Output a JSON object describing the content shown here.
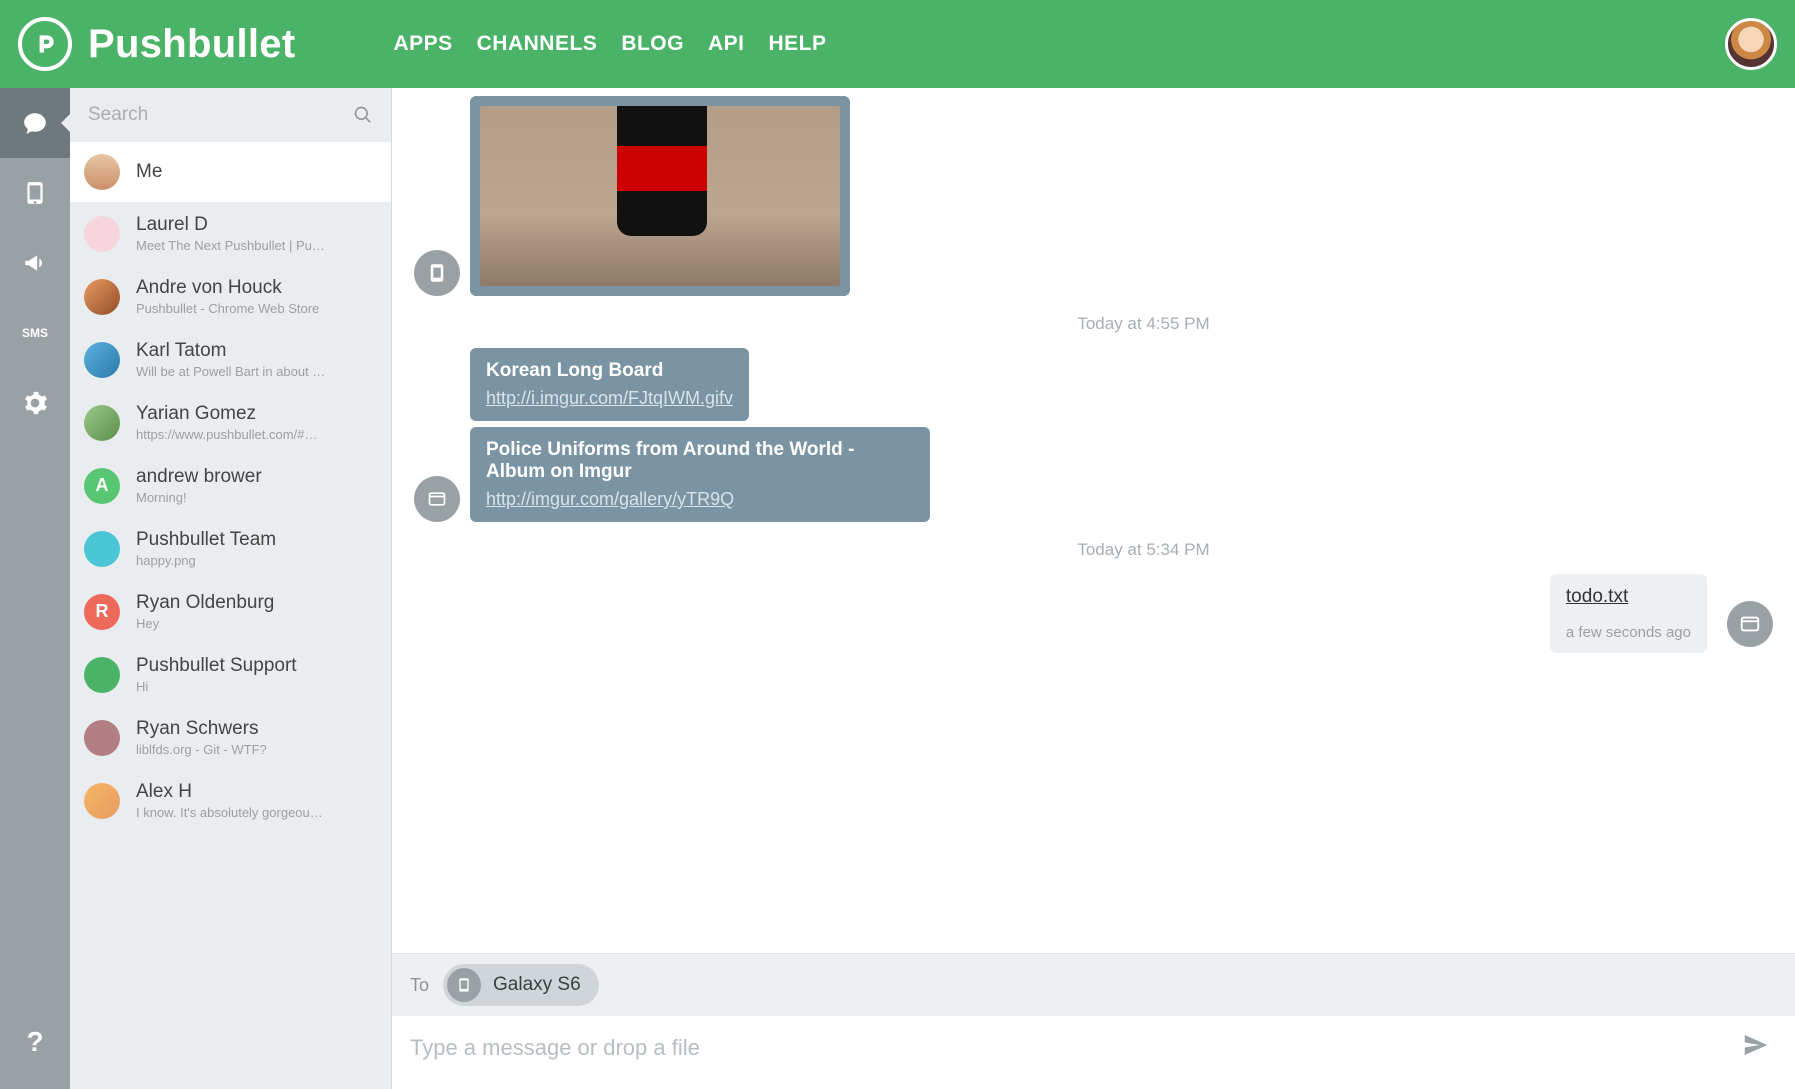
{
  "brand": {
    "name": "Pushbullet"
  },
  "nav": {
    "apps": "APPS",
    "channels": "CHANNELS",
    "blog": "BLOG",
    "api": "API",
    "help": "HELP"
  },
  "sidenav": {
    "sms_label": "SMS",
    "help_label": "?"
  },
  "search": {
    "placeholder": "Search"
  },
  "contacts": [
    {
      "name": "Me",
      "preview": "",
      "avatar_class": "c-face",
      "initial": ""
    },
    {
      "name": "Laurel D",
      "preview": "Meet The Next Pushbullet | Pu…",
      "avatar_class": "c-pink",
      "initial": ""
    },
    {
      "name": "Andre von Houck",
      "preview": "Pushbullet - Chrome Web Store",
      "avatar_class": "c-photo1",
      "initial": ""
    },
    {
      "name": "Karl Tatom",
      "preview": "Will be at Powell Bart in about …",
      "avatar_class": "c-photo2",
      "initial": ""
    },
    {
      "name": "Yarian Gomez",
      "preview": "https://www.pushbullet.com/#…",
      "avatar_class": "c-photo3",
      "initial": ""
    },
    {
      "name": "andrew brower",
      "preview": "Morning!",
      "avatar_class": "c-green",
      "initial": "A"
    },
    {
      "name": "Pushbullet Team",
      "preview": "happy.png",
      "avatar_class": "c-teal",
      "initial": ""
    },
    {
      "name": "Ryan Oldenburg",
      "preview": "Hey",
      "avatar_class": "c-red",
      "initial": "R"
    },
    {
      "name": "Pushbullet Support",
      "preview": "Hi",
      "avatar_class": "c-pb",
      "initial": ""
    },
    {
      "name": "Ryan Schwers",
      "preview": "liblfds.org - Git - WTF?",
      "avatar_class": "c-plum",
      "initial": ""
    },
    {
      "name": "Alex H",
      "preview": "I know. It's absolutely gorgeou…",
      "avatar_class": "c-pair",
      "initial": ""
    }
  ],
  "thread": {
    "ts1": "Today at 4:55 PM",
    "ts2": "Today at 5:34 PM",
    "msg1": {
      "title": "Korean Long Board",
      "url": "http://i.imgur.com/FJtqIWM.gifv"
    },
    "msg2": {
      "title": "Police Uniforms from Around the World - Album on Imgur",
      "url": "http://imgur.com/gallery/yTR9Q"
    },
    "file": {
      "name": "todo.txt",
      "time": "a few seconds ago"
    }
  },
  "compose": {
    "to_label": "To",
    "chip_label": "Galaxy S6",
    "placeholder": "Type a message or drop a file"
  }
}
